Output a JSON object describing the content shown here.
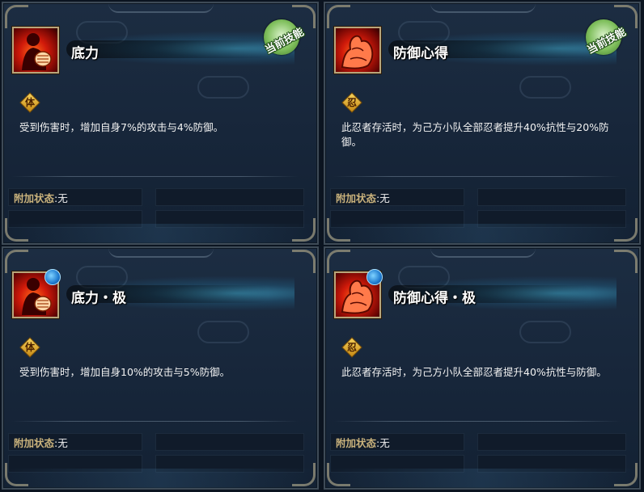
{
  "cards": [
    {
      "name": "底力",
      "current": true,
      "current_label": "当前技能",
      "enhanced": false,
      "type": "体",
      "icon": "fist-shadow-icon",
      "description": "受到伤害时，增加自身7%的攻击与4%防御。",
      "status_label": "附加状态",
      "status_value": ":无"
    },
    {
      "name": "防御心得",
      "current": true,
      "current_label": "当前技能",
      "enhanced": false,
      "type": "忍",
      "icon": "muscle-arm-icon",
      "description": "此忍者存活时，为己方小队全部忍者提升40%抗性与20%防御。",
      "status_label": "附加状态",
      "status_value": ":无"
    },
    {
      "name": "底力・极",
      "current": false,
      "current_label": "",
      "enhanced": true,
      "type": "体",
      "icon": "fist-shadow-icon",
      "description": "受到伤害时，增加自身10%的攻击与5%防御。",
      "status_label": "附加状态",
      "status_value": ":无"
    },
    {
      "name": "防御心得・极",
      "current": false,
      "current_label": "",
      "enhanced": true,
      "type": "忍",
      "icon": "muscle-arm-icon",
      "description": "此忍者存活时，为己方小队全部忍者提升40%抗性与防御。",
      "status_label": "附加状态",
      "status_value": ":无"
    }
  ]
}
